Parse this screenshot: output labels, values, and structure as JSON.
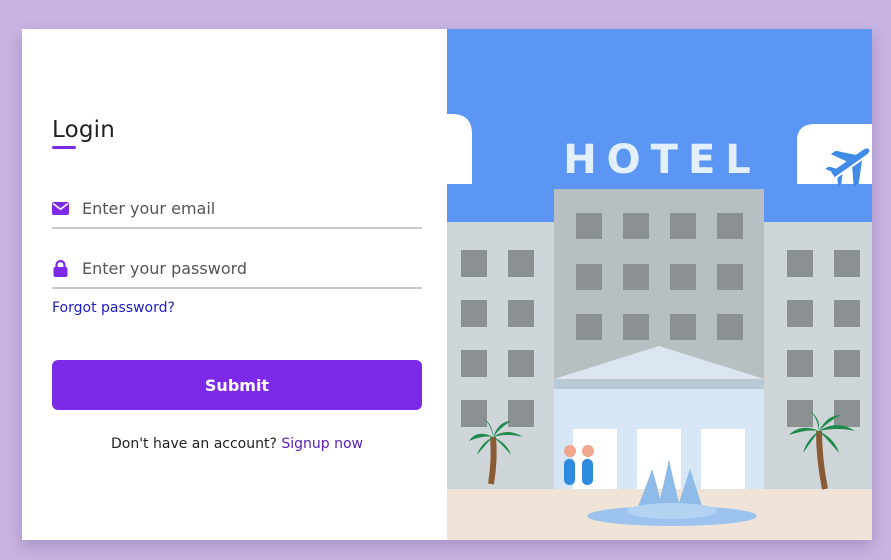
{
  "login": {
    "title": "Login",
    "email_placeholder": "Enter your email",
    "password_placeholder": "Enter your password",
    "forgot_label": "Forgot password?",
    "submit_label": "Submit",
    "signup_prompt": "Don't have an account?",
    "signup_link": "Signup now"
  },
  "illustration": {
    "sign_text": "HOTEL"
  },
  "colors": {
    "accent": "#7d2ae8",
    "background": "#c8b4e2",
    "link": "#1d1dbf",
    "sky": "#5b96f5"
  },
  "icons": [
    "envelope-icon",
    "lock-icon",
    "airplane-icon"
  ]
}
